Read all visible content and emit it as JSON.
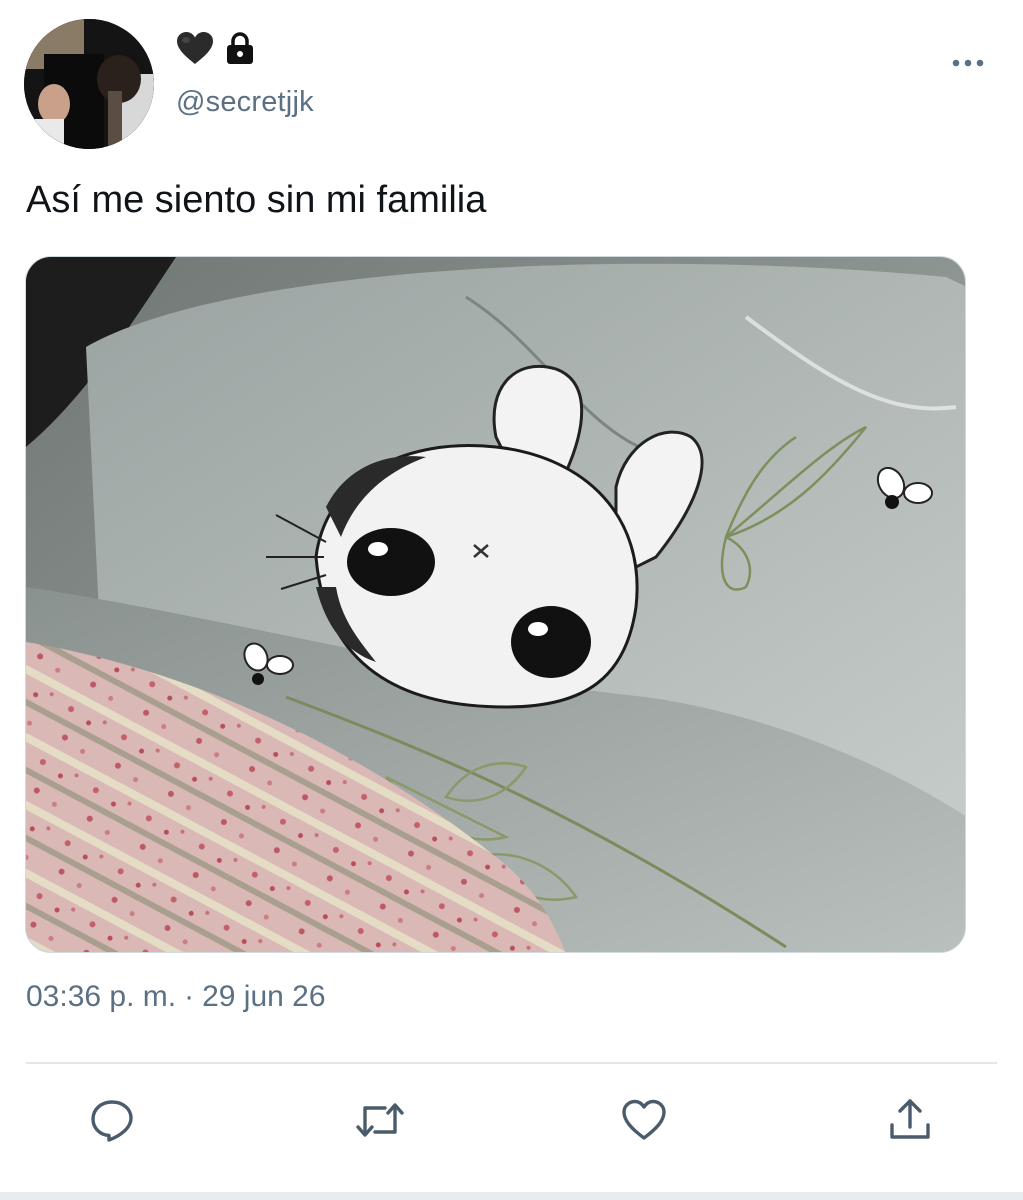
{
  "tweet": {
    "display_name_icons": [
      "black-heart-icon",
      "lock-icon"
    ],
    "handle": "@secretjjk",
    "text": "Así me siento sin mi familia",
    "media": {
      "subject": "illustration"
    },
    "time": "03:36 p. m.",
    "separator": "·",
    "date": "29 jun 26"
  },
  "actions": [
    {
      "name": "reply",
      "icon": "reply-icon"
    },
    {
      "name": "retweet",
      "icon": "retweet-icon"
    },
    {
      "name": "like",
      "icon": "heart-icon"
    },
    {
      "name": "share",
      "icon": "share-icon"
    }
  ],
  "colors": {
    "text_primary": "#0f1419",
    "text_secondary": "#5b7083",
    "icon": "#4a5b6b",
    "divider": "#e1e8ed"
  }
}
